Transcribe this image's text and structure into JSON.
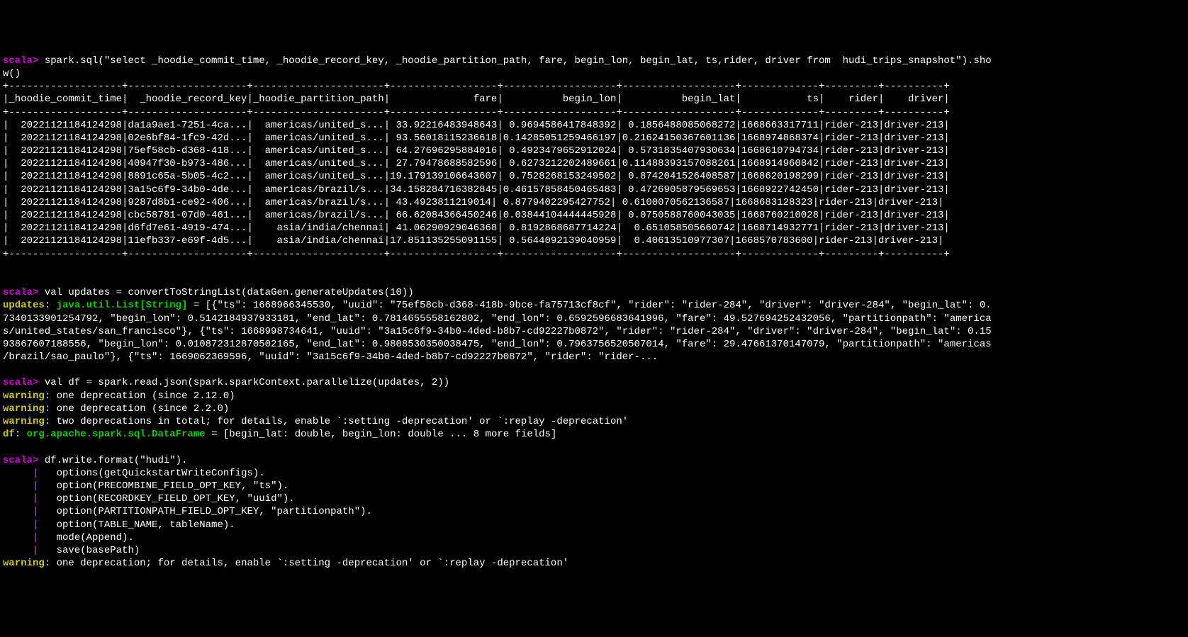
{
  "cmd1": {
    "prompt": "scala>",
    "text": " spark.sql(\"select _hoodie_commit_time, _hoodie_record_key, _hoodie_partition_path, fare, begin_lon, begin_lat, ts,rider, driver from  hudi_trips_snapshot\").sho\nw()"
  },
  "table": {
    "sep": "+-------------------+--------------------+----------------------+------------------+-------------------+-------------------+-------------+---------+----------+",
    "header": "|_hoodie_commit_time|  _hoodie_record_key|_hoodie_partition_path|              fare|          begin_lon|          begin_lat|           ts|    rider|    driver|",
    "rows": [
      "|  20221121184124298|da1a9ae1-7251-4ca...|  americas/united_s...| 33.92216483948643| 0.9694586417848392| 0.1856488085068272|1668663317711|rider-213|driver-213|",
      "|  20221121184124298|02e6bf84-1fc9-42d...|  americas/united_s...| 93.56018115236618|0.14285051259466197|0.21624150367601136|1668974868374|rider-213|driver-213|",
      "|  20221121184124298|75ef58cb-d368-418...|  americas/united_s...| 64.27696295884016| 0.4923479652912024| 0.5731835407930634|1668610794734|rider-213|driver-213|",
      "|  20221121184124298|40947f30-b973-486...|  americas/united_s...| 27.79478688582596| 0.6273212202489661|0.11488393157088261|1668914960842|rider-213|driver-213|",
      "|  20221121184124298|8891c65a-5b05-4c2...|  americas/united_s...|19.179139106643607| 0.7528268153249502| 0.8742041526408587|1668620198299|rider-213|driver-213|",
      "|  20221121184124298|3a15c6f9-34b0-4de...|  americas/brazil/s...|34.158284716382845|0.46157858450465483| 0.4726905879569653|1668922742450|rider-213|driver-213|",
      "|  20221121184124298|9287d8b1-ce92-406...|  americas/brazil/s...| 43.4923811219014| 0.8779402295427752| 0.6100070562136587|1668683128323|rider-213|driver-213|",
      "|  20221121184124298|cbc58781-07d0-461...|  americas/brazil/s...| 66.62084366450246|0.03844104444445928| 0.0750588760043035|1668760210028|rider-213|driver-213|",
      "|  20221121184124298|d6fd7e61-4919-474...|    asia/india/chennai| 41.06290929046368| 0.8192868687714224|  0.651058505660742|1668714932771|rider-213|driver-213|",
      "|  20221121184124298|11efb337-e69f-4d5...|    asia/india/chennai|17.851135255091155| 0.5644092139040959|  0.40613510977307|1668570783600|rider-213|driver-213|"
    ]
  },
  "cmd2": {
    "prompt": "scala>",
    "text": " val updates = convertToStringList(dataGen.generateUpdates(10))"
  },
  "updates_out": {
    "varname": "updates",
    "colon": ": ",
    "type": "java.util.List[String]",
    "rest": " = [{\"ts\": 1668966345530, \"uuid\": \"75ef58cb-d368-418b-9bce-fa75713cf8cf\", \"rider\": \"rider-284\", \"driver\": \"driver-284\", \"begin_lat\": 0.\n7340133901254792, \"begin_lon\": 0.5142184937933181, \"end_lat\": 0.7814655558162802, \"end_lon\": 0.6592596683641996, \"fare\": 49.527694252432056, \"partitionpath\": \"america\ns/united_states/san_francisco\"}, {\"ts\": 1668998734641, \"uuid\": \"3a15c6f9-34b0-4ded-b8b7-cd92227b0872\", \"rider\": \"rider-284\", \"driver\": \"driver-284\", \"begin_lat\": 0.15\n93867607188556, \"begin_lon\": 0.010872312870502165, \"end_lat\": 0.9808530350038475, \"end_lon\": 0.7963756520507014, \"fare\": 29.47661370147079, \"partitionpath\": \"americas\n/brazil/sao_paulo\"}, {\"ts\": 1669062369596, \"uuid\": \"3a15c6f9-34b0-4ded-b8b7-cd92227b0872\", \"rider\": \"rider-..."
  },
  "cmd3": {
    "prompt": "scala>",
    "text": " val df = spark.read.json(spark.sparkContext.parallelize(updates, 2))"
  },
  "warn1": {
    "label": "warning:",
    "text": " one deprecation (since 2.12.0)"
  },
  "warn2": {
    "label": "warning:",
    "text": " one deprecation (since 2.2.0)"
  },
  "warn3": {
    "label": "warning:",
    "text": " two deprecations in total; for details, enable `:setting -deprecation' or `:replay -deprecation'"
  },
  "df_out": {
    "varname": "df",
    "colon": ": ",
    "type": "org.apache.spark.sql.DataFrame",
    "rest": " = [begin_lat: double, begin_lon: double ... 8 more fields]"
  },
  "cmd4": {
    "prompt": "scala>",
    "text": " df.write.format(\"hudi\")."
  },
  "cont_lines": [
    "   options(getQuickstartWriteConfigs).",
    "   option(PRECOMBINE_FIELD_OPT_KEY, \"ts\").",
    "   option(RECORDKEY_FIELD_OPT_KEY, \"uuid\").",
    "   option(PARTITIONPATH_FIELD_OPT_KEY, \"partitionpath\").",
    "   option(TABLE_NAME, tableName).",
    "   mode(Append).",
    "   save(basePath)"
  ],
  "warn4": {
    "label": "warning:",
    "text": " one deprecation; for details, enable `:setting -deprecation' or `:replay -deprecation'"
  }
}
